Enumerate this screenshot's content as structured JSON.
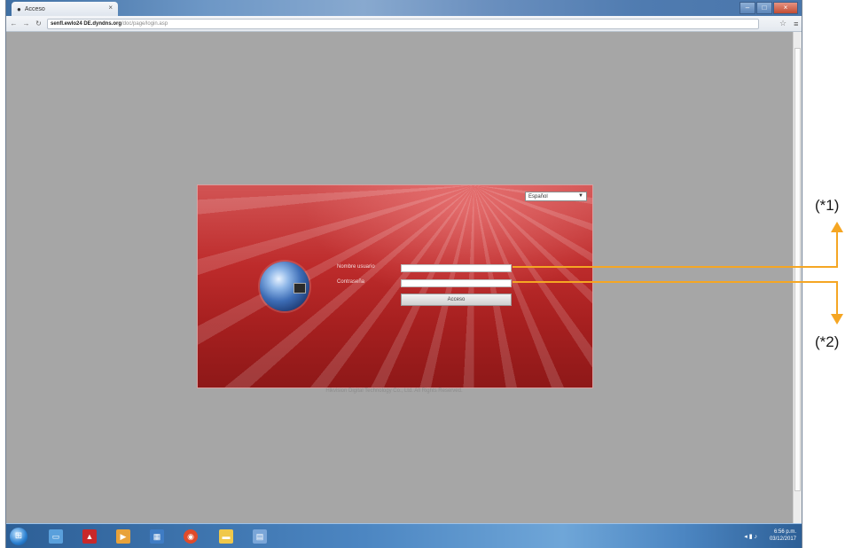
{
  "browser": {
    "tab_title": "Acceso",
    "tab_close": "×",
    "url_host": "senfl.ewlo24 DE.dyndns.org",
    "url_path": "/doc/page/login.asp",
    "window_buttons": {
      "minimize": "–",
      "maximize": "□",
      "close": "×"
    }
  },
  "login": {
    "language": "Español",
    "username_label": "Nombre usuario",
    "password_label": "Contraseña",
    "login_button": "Acceso",
    "copyright": "Hikvision Digital Technology Co., Ltd. All Rights Reserved."
  },
  "taskbar": {
    "clock_time": "6:56 p.m.",
    "clock_date": "03/12/2017"
  },
  "annotations": {
    "note_1": "(*1)",
    "note_2": "(*2)"
  },
  "colors": {
    "callout": "#f5a623",
    "panel_red": "#b92a2a",
    "page_gray": "#a6a6a6"
  }
}
